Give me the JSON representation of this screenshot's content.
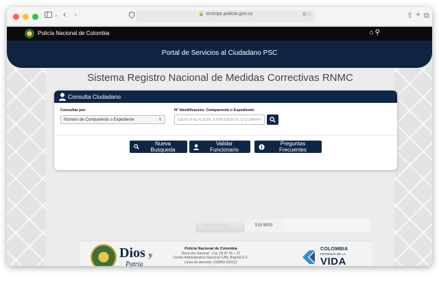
{
  "browser": {
    "url": "srvcnpc.policia.gov.co",
    "icons": [
      "sidebar-icon",
      "chevron-down-icon",
      "back-icon",
      "forward-icon",
      "shield-icon",
      "lock-icon",
      "translate-icon",
      "reload-icon",
      "share-icon",
      "plus-icon",
      "tabs-icon"
    ]
  },
  "nav": {
    "title": "Policía Nacional de Colombia",
    "icons": [
      "home-icon",
      "search-icon"
    ]
  },
  "banner": {
    "title": "Portal de Servicios al Ciudadano PSC"
  },
  "main": {
    "title": "Sistema Registro Nacional de Medidas Correctivas RNMC"
  },
  "consulta": {
    "header": "Consulta Ciudadano",
    "consultar_label": "Consultar por:",
    "consultar_value": "Número de Comparendo o Expediente",
    "id_label": "N° Identificación, Comparendo o Expediente:",
    "id_placeholder": "IDENTIFICACIÓN, EXPEDIENTE O COMPAREND"
  },
  "buttons": {
    "nueva": "Nueva Busqueda",
    "validar": "Validar Funcionario",
    "preguntas": "Preguntas Frecuentes"
  },
  "footer": {
    "tab_faded": "Información",
    "phone": "515 9000",
    "motto_1": "Dios",
    "motto_y": "y",
    "motto_2": "Patria",
    "org": "Policía Nacional de Colombia",
    "address_1": "Dirección General - Cra. 59 Nº 26 – 21",
    "address_2": "Centro Administrativo Nacional CAN, Bogotá D.C.",
    "line": "Línea de atención: 018000-910112",
    "gov_1": "COLOMBIA",
    "gov_2": "POTENCIA DE LA",
    "gov_3": "VIDA"
  },
  "colors": {
    "navy": "#0e2747",
    "banner": "#102442",
    "nav_black": "#0b0b0b"
  }
}
